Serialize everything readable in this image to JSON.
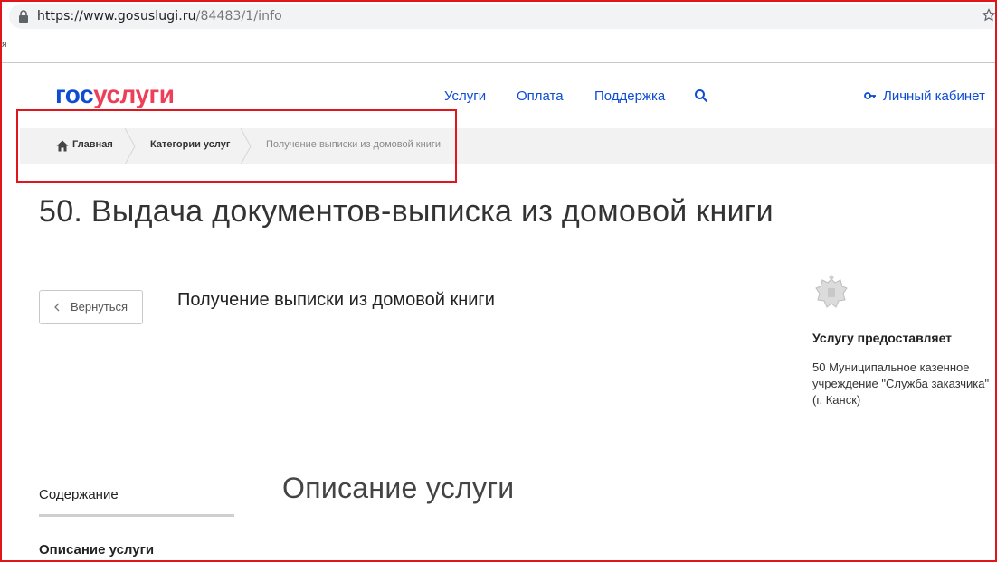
{
  "browser": {
    "url_main": "https://www.gosuslugi.ru",
    "url_path": "/84483/1/info",
    "bookmark_fragment": "я"
  },
  "header": {
    "logo_part1": "гос",
    "logo_part2": "услуги",
    "nav": [
      "Услуги",
      "Оплата",
      "Поддержка"
    ],
    "cabinet_label": "Личный кабинет",
    "colors": {
      "brand_blue": "#0d4cd3",
      "brand_red": "#ee3f58"
    }
  },
  "breadcrumb": {
    "items": [
      "Главная",
      "Категории услуг",
      "Получение выписки из домовой книги"
    ]
  },
  "page": {
    "title": "50. Выдача документов-выписка из домовой книги",
    "back_label": "Вернуться",
    "subtitle": "Получение выписки из домовой книги"
  },
  "provider": {
    "heading": "Услугу предоставляет",
    "name_line1": "50 Муниципальное казенное",
    "name_line2": "учреждение \"Служба заказчика\"",
    "name_line3": "(г. Канск)"
  },
  "contents": {
    "heading": "Содержание",
    "items": [
      "Описание услуги"
    ]
  },
  "section": {
    "title": "Описание услуги"
  }
}
